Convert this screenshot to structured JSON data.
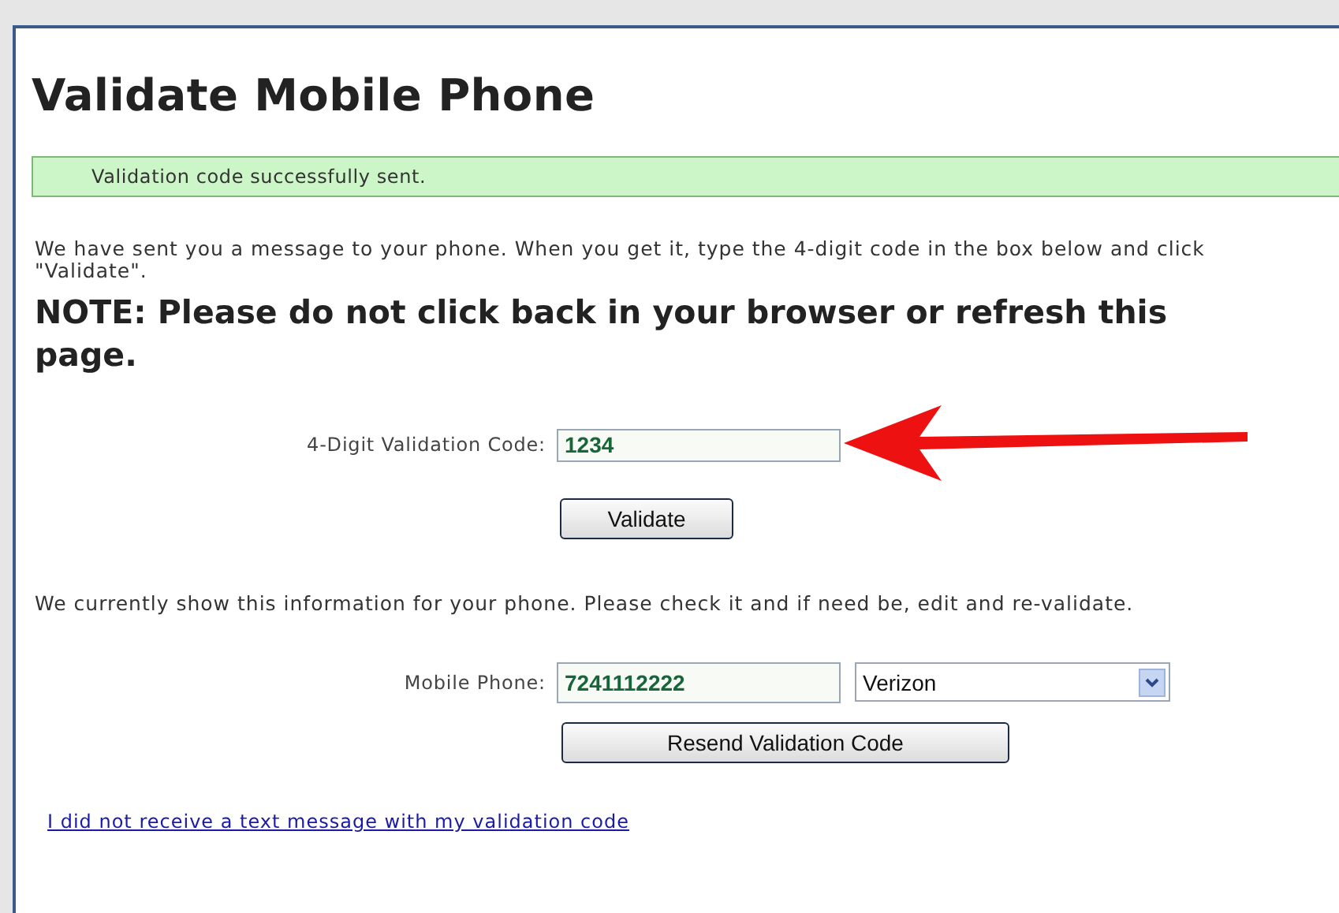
{
  "title": "Validate Mobile Phone",
  "success_message": "Validation code successfully sent.",
  "instructions": "We have sent you a message to your phone. When you get it, type the 4-digit code in the box below and click \"Validate\".",
  "note": "NOTE: Please do not click back in your browser or refresh this page.",
  "code_field": {
    "label": "4-Digit Validation Code:",
    "value": "1234"
  },
  "validate_button": "Validate",
  "info_text": "We currently show this information for your phone. Please check it and if need be, edit and re-validate.",
  "phone_field": {
    "label": "Mobile Phone:",
    "value": "7241112222"
  },
  "carrier_select": {
    "value": "Verizon"
  },
  "resend_button": "Resend Validation Code",
  "help_link": "I did not receive a text message with my validation code"
}
